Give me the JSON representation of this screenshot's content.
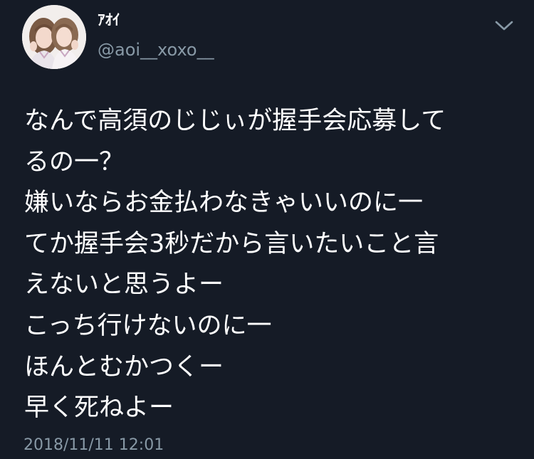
{
  "tweet": {
    "user": {
      "display_name": "ｱｵｲ",
      "handle": "@aoi__xoxo__",
      "avatar_icon": "profile-photo"
    },
    "menu_icon": "chevron-down-icon",
    "text_lines": [
      "なんで高須のじじぃが握手会応募して",
      "るの一？",
      "嫌いならお金払わなきゃいいのに一",
      "てか握手会3秒だから言いたいこと言",
      "えないと思うよー",
      "こっち行けないのに一",
      "ほんとむかつくー",
      "早く死ねよー"
    ],
    "timestamp": "2018/11/11 12:01"
  },
  "colors": {
    "background": "#151b26",
    "text": "#ffffff",
    "secondary_text": "#8899a6"
  }
}
